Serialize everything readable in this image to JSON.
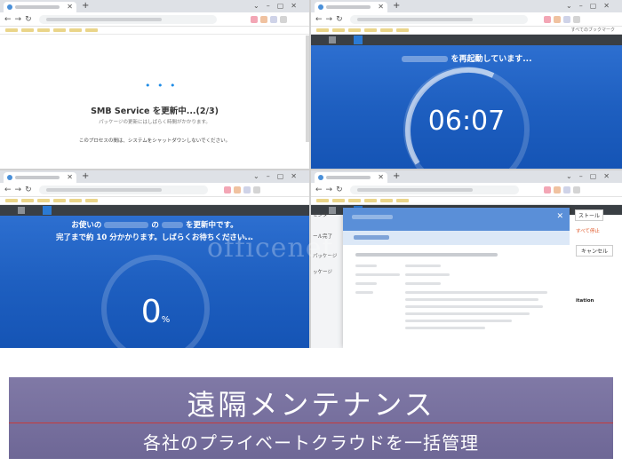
{
  "screen1": {
    "title": "SMB Service を更新中...(2/3)",
    "subtitle": "パッケージの更新にはしばらく時間がかかります。",
    "warning": "このプロセスの間は、システムをシャットダウンしないでください。"
  },
  "screen2": {
    "restart_text": "を再起動しています...",
    "timer": "06:07"
  },
  "screen3": {
    "line1_prefix": "お使いの",
    "line1_mid": "の",
    "line1_suffix": "を更新中です。",
    "line2": "完了まで約 10 分かかります。しばらくお待ちください...",
    "percent_value": "0",
    "percent_unit": "%",
    "progress": 0
  },
  "screen4": {
    "left_items": [
      "センター",
      "ール完了",
      "パッケージ",
      "ッケージ"
    ],
    "right_button": "ストール",
    "right_link": "すべて停止",
    "right_cancel": "キャンセル",
    "right_label": "itation"
  },
  "browser": {
    "bookmarks_label": "すべてのブックマーク"
  },
  "watermark": "officenet",
  "banner": {
    "title": "遠隔メンテナンス",
    "subtitle": "各社のプライベートクラウドを一括管理"
  },
  "colors": {
    "accent": "#1f8ce6",
    "screen_blue": "#1e5fc0",
    "banner": "#7a73a2",
    "divider": "#c63b3b"
  }
}
